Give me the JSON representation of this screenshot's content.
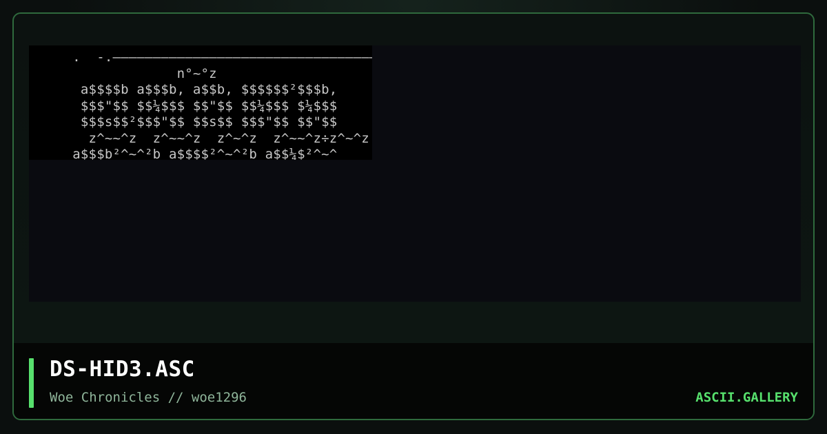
{
  "artwork": {
    "ascii_text": "  .  -.——————————————————————————————————————\n               n°~°z\n   a$$$$b a$$$b, a$$b, $$$$$$²$$$b,\n   $$$\"$$ $$¼$$$ $$\"$$ $$¼$$$ $¼$$$\n   $$$s$$²$$$\"$$ $$s$$ $$$\"$$ $$\"$$\n    z^~~^z  z^~~^z  z^~^z  z^~~^z÷z^~^z\n  a$$$b²^~^²b a$$$$²^~^²b a$$¼$²^~^"
  },
  "footer": {
    "title": "DS-HID3.ASC",
    "subtitle": "Woe Chronicles // woe1296",
    "brand": "ASCII.GALLERY"
  },
  "colors": {
    "accent": "#57e06d",
    "border": "#2f6a3d",
    "background": "#0b0f0e",
    "art_text": "#c8c8c8"
  }
}
